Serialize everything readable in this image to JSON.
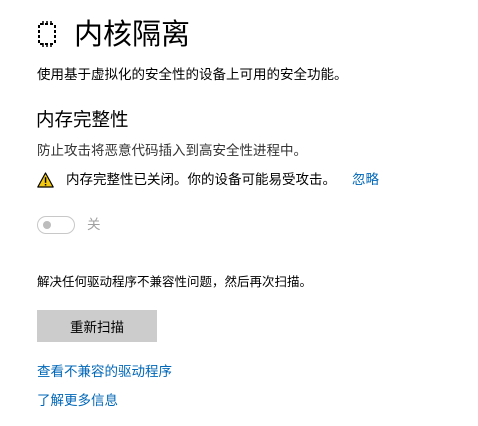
{
  "header": {
    "title": "内核隔离",
    "icon": "core-isolation-chip-icon"
  },
  "description": "使用基于虚拟化的安全性的设备上可用的安全功能。",
  "memory_integrity": {
    "title": "内存完整性",
    "description": "防止攻击将恶意代码插入到高安全性进程中。",
    "warning": {
      "icon": "warning-icon",
      "icon_color": "#f2c811",
      "text": "内存完整性已关闭。你的设备可能易受攻击。",
      "dismiss_label": "忽略"
    },
    "toggle": {
      "state": "off",
      "label": "关"
    }
  },
  "resolve_text": "解决任何驱动程序不兼容性问题，然后再次扫描。",
  "rescan_button_label": "重新扫描",
  "links": {
    "view_incompatible_drivers": "查看不兼容的驱动程序",
    "learn_more": "了解更多信息"
  },
  "colors": {
    "link": "#0067b8",
    "button_bg": "#cccccc"
  }
}
